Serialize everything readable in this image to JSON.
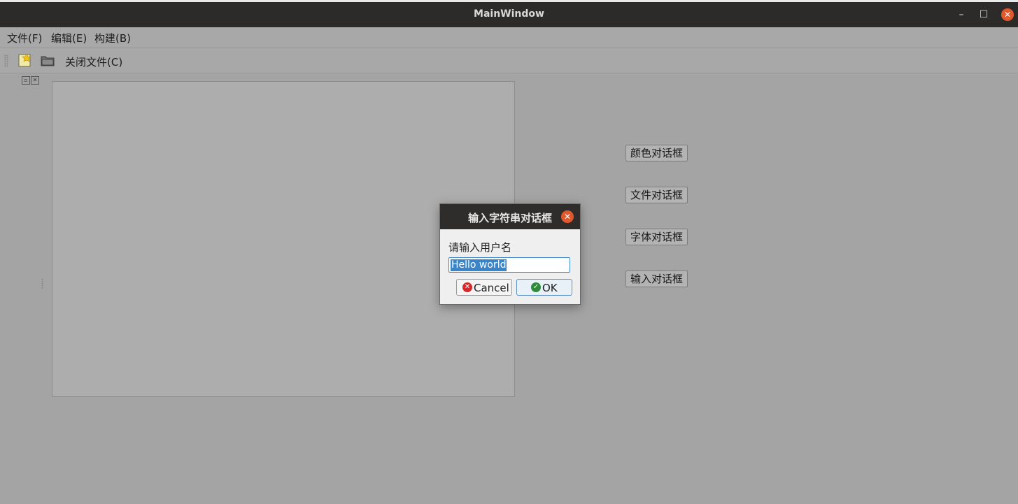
{
  "window": {
    "title": "MainWindow",
    "minimize_label": "–",
    "maximize_label": "☐",
    "close_label": "✕"
  },
  "menubar": {
    "items": [
      {
        "label": "文件(F)"
      },
      {
        "label": "编辑(E)"
      },
      {
        "label": "构建(B)"
      }
    ]
  },
  "toolbar": {
    "new_icon": "new-file-icon",
    "open_icon": "open-folder-icon",
    "close_file_label": "关闭文件(C)"
  },
  "side_buttons": [
    {
      "label": "颜色对话框"
    },
    {
      "label": "文件对话框"
    },
    {
      "label": "字体对话框"
    },
    {
      "label": "输入对话框"
    }
  ],
  "dialog": {
    "title": "输入字符串对话框",
    "close_label": "✕",
    "prompt": "请输入用户名",
    "input_value": "Hello world",
    "cancel_label": "Cancel",
    "ok_label": "OK"
  },
  "colors": {
    "accent": "#3a84c9",
    "close": "#e0582c",
    "titlebar": "#2d2b2a"
  }
}
